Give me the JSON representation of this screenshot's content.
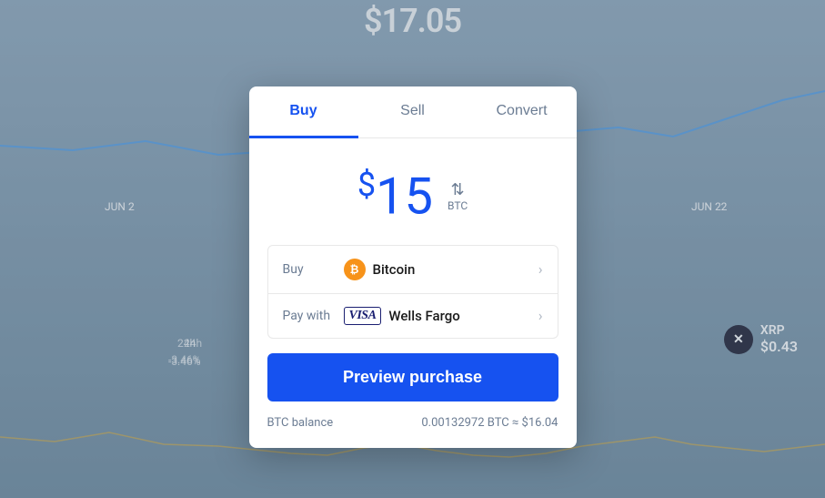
{
  "background": {
    "price": "$17.05",
    "labels": {
      "jun2": "JUN 2",
      "jun22": "JUN 22",
      "hours24": "24h",
      "change": "-3.46%"
    }
  },
  "xrp": {
    "symbol": "XRP",
    "price": "$0.43",
    "icon": "✕"
  },
  "modal": {
    "tabs": [
      {
        "label": "Buy",
        "active": true
      },
      {
        "label": "Sell",
        "active": false
      },
      {
        "label": "Convert",
        "active": false
      }
    ],
    "amount": {
      "dollar_sign": "$",
      "value": "15",
      "currency": "BTC",
      "arrows": "⇅"
    },
    "buy_row": {
      "label": "Buy",
      "asset_name": "Bitcoin",
      "icon_letter": "₿"
    },
    "pay_row": {
      "label": "Pay with",
      "bank_name": "Wells Fargo",
      "visa_text": "VISA"
    },
    "preview_button": "Preview purchase",
    "balance": {
      "label": "BTC balance",
      "amount": "0.00132972 BTC",
      "approx": "≈ $16.04"
    }
  }
}
